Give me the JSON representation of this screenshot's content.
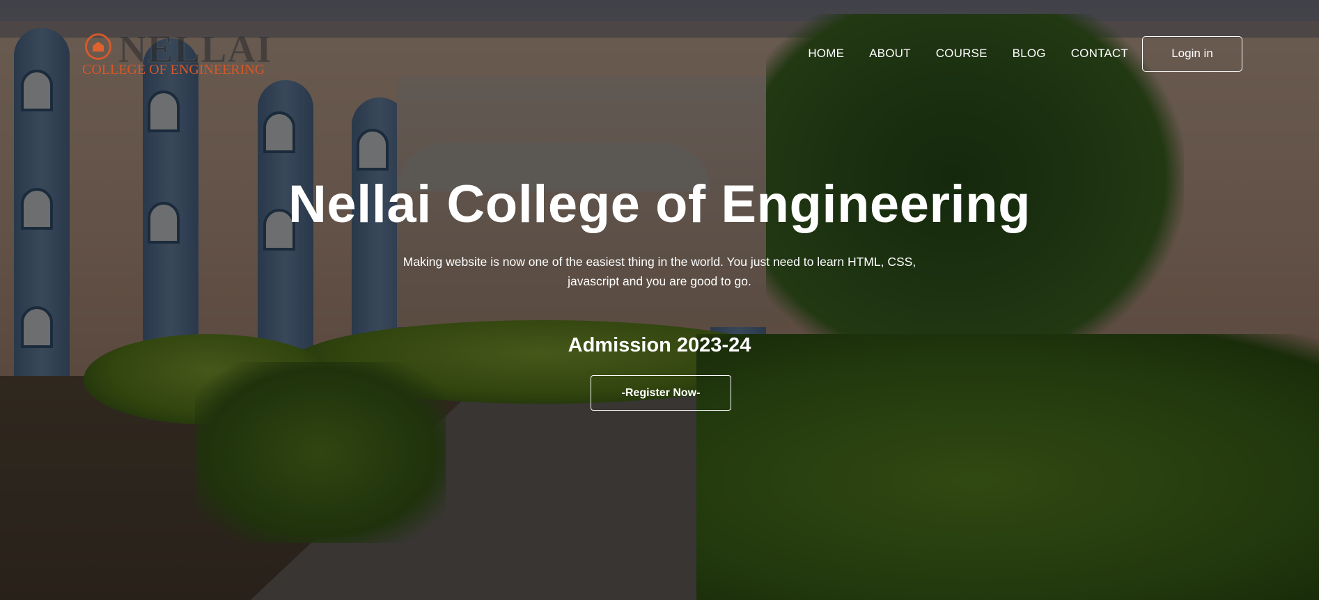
{
  "brand": {
    "logo_word": "NELLAI",
    "logo_subtitle": "COLLEGE OF ENGINEERING",
    "accent_color": "#d5592a"
  },
  "nav": {
    "items": [
      {
        "label": "HOME"
      },
      {
        "label": "ABOUT"
      },
      {
        "label": "COURSE"
      },
      {
        "label": "BLOG"
      },
      {
        "label": "CONTACT"
      }
    ],
    "login_label": "Login in"
  },
  "hero": {
    "title": "Nellai College of Engineering",
    "description": "Making website is now one of the easiest thing in the world. You just need to learn HTML, CSS, javascript and you are good to go.",
    "admission": "Admission 2023-24",
    "register_label": "-Register Now-"
  },
  "icons": {
    "logo_emblem": "college-emblem-icon"
  }
}
